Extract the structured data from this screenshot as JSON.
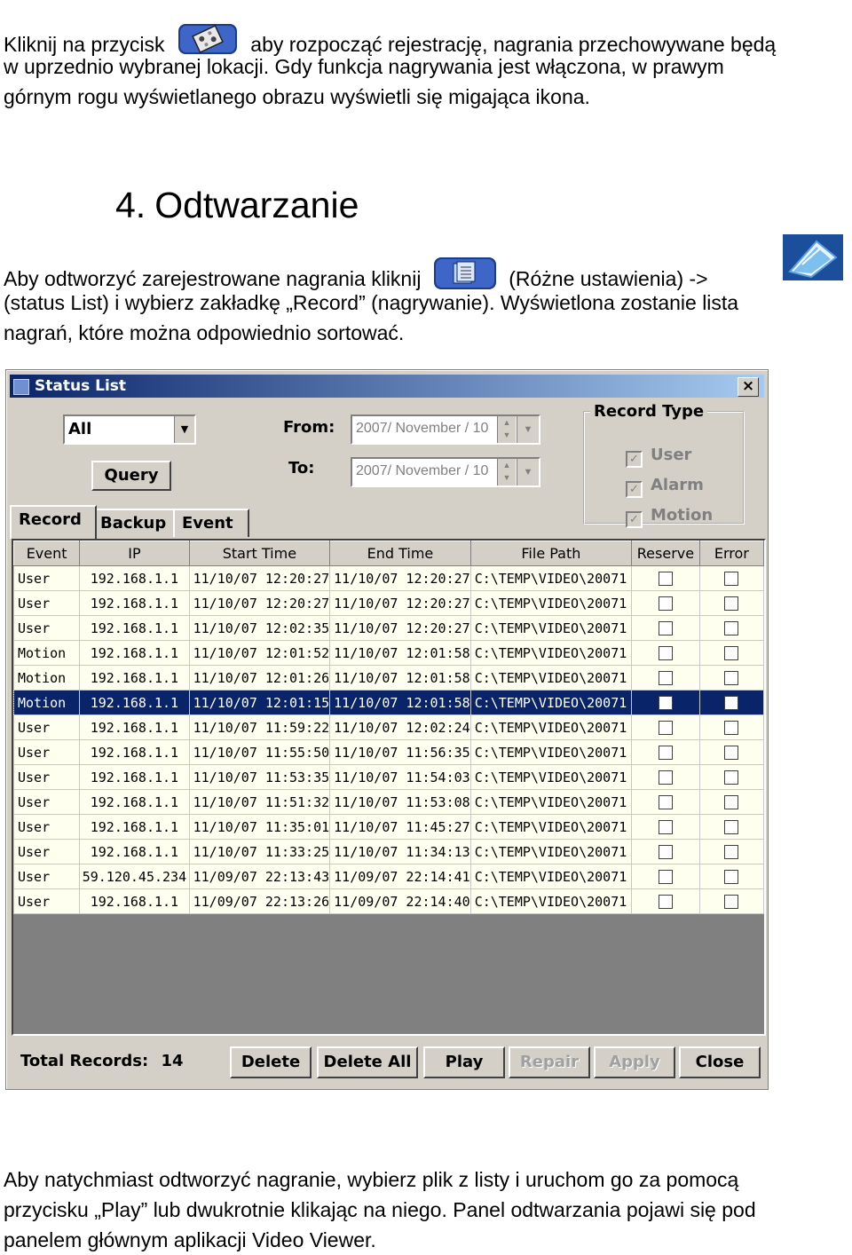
{
  "intro": {
    "line1_part1": "Kliknij na przycisk",
    "line1_part2": "aby rozpocząć rejestrację, nagrania przechowywane będą",
    "line2": "w uprzednio wybranej lokacji. Gdy funkcja nagrywania jest włączona, w prawym",
    "line3": "górnym rogu wyświetlanego obrazu wyświetli się migająca ikona."
  },
  "section": {
    "number": "4.",
    "title": "Odtwarzanie"
  },
  "playback_text": {
    "line1_part1": "Aby odtworzyć zarejestrowane nagrania kliknij",
    "line1_part2": "(Różne ustawienia) ->",
    "line2": "(status List) i wybierz zakładkę „Record” (nagrywanie). Wyświetlona zostanie lista",
    "line3": "nagrań, które można odpowiednio sortować."
  },
  "icons": {
    "record_button": "record-icon",
    "misc_settings": "misc-settings-icon",
    "status_list": "status-list-icon"
  },
  "dialog": {
    "title": "Status List",
    "close": "×",
    "filter_value": "All",
    "query_label": "Query",
    "from_label": "From:",
    "to_label": "To:",
    "from_value": "2007/ November / 10",
    "to_value": "2007/ November / 10",
    "record_type": {
      "legend": "Record Type",
      "options": [
        "User",
        "Alarm",
        "Motion"
      ]
    },
    "tabs": [
      "Record",
      "Backup",
      "Event"
    ],
    "columns": [
      "Event",
      "IP",
      "Start Time",
      "End Time",
      "File Path",
      "Reserve",
      "Error"
    ],
    "rows": [
      {
        "event": "User",
        "ip": "192.168.1.1",
        "start": "11/10/07 12:20:27",
        "end": "11/10/07 12:20:27",
        "path": "C:\\TEMP\\VIDEO\\20071"
      },
      {
        "event": "User",
        "ip": "192.168.1.1",
        "start": "11/10/07 12:20:27",
        "end": "11/10/07 12:20:27",
        "path": "C:\\TEMP\\VIDEO\\20071"
      },
      {
        "event": "User",
        "ip": "192.168.1.1",
        "start": "11/10/07 12:02:35",
        "end": "11/10/07 12:20:27",
        "path": "C:\\TEMP\\VIDEO\\20071"
      },
      {
        "event": "Motion",
        "ip": "192.168.1.1",
        "start": "11/10/07 12:01:52",
        "end": "11/10/07 12:01:58",
        "path": "C:\\TEMP\\VIDEO\\20071"
      },
      {
        "event": "Motion",
        "ip": "192.168.1.1",
        "start": "11/10/07 12:01:26",
        "end": "11/10/07 12:01:58",
        "path": "C:\\TEMP\\VIDEO\\20071"
      },
      {
        "event": "Motion",
        "ip": "192.168.1.1",
        "start": "11/10/07 12:01:15",
        "end": "11/10/07 12:01:58",
        "path": "C:\\TEMP\\VIDEO\\20071"
      },
      {
        "event": "User",
        "ip": "192.168.1.1",
        "start": "11/10/07 11:59:22",
        "end": "11/10/07 12:02:24",
        "path": "C:\\TEMP\\VIDEO\\20071"
      },
      {
        "event": "User",
        "ip": "192.168.1.1",
        "start": "11/10/07 11:55:50",
        "end": "11/10/07 11:56:35",
        "path": "C:\\TEMP\\VIDEO\\20071"
      },
      {
        "event": "User",
        "ip": "192.168.1.1",
        "start": "11/10/07 11:53:35",
        "end": "11/10/07 11:54:03",
        "path": "C:\\TEMP\\VIDEO\\20071"
      },
      {
        "event": "User",
        "ip": "192.168.1.1",
        "start": "11/10/07 11:51:32",
        "end": "11/10/07 11:53:08",
        "path": "C:\\TEMP\\VIDEO\\20071"
      },
      {
        "event": "User",
        "ip": "192.168.1.1",
        "start": "11/10/07 11:35:01",
        "end": "11/10/07 11:45:27",
        "path": "C:\\TEMP\\VIDEO\\20071"
      },
      {
        "event": "User",
        "ip": "192.168.1.1",
        "start": "11/10/07 11:33:25",
        "end": "11/10/07 11:34:13",
        "path": "C:\\TEMP\\VIDEO\\20071"
      },
      {
        "event": "User",
        "ip": "59.120.45.234",
        "start": "11/09/07 22:13:43",
        "end": "11/09/07 22:14:41",
        "path": "C:\\TEMP\\VIDEO\\20071"
      },
      {
        "event": "User",
        "ip": "192.168.1.1",
        "start": "11/09/07 22:13:26",
        "end": "11/09/07 22:14:40",
        "path": "C:\\TEMP\\VIDEO\\20071"
      }
    ],
    "selected_row": 5,
    "total_label": "Total Records:",
    "total_value": "14",
    "buttons": {
      "delete": "Delete",
      "delete_all": "Delete All",
      "play": "Play",
      "repair": "Repair",
      "apply": "Apply",
      "close": "Close"
    },
    "colors": {
      "selection": "#0a246a",
      "title_start": "#0a246a",
      "title_end": "#a6caf0",
      "face": "#d4d0c8"
    }
  },
  "outro": {
    "line1": "Aby natychmiast odtworzyć nagranie, wybierz plik z listy i uruchom go za pomocą",
    "line2": "przycisku „Play” lub dwukrotnie klikając na niego. Panel odtwarzania pojawi się pod",
    "line3": "panelem głównym aplikacji Video Viewer."
  }
}
